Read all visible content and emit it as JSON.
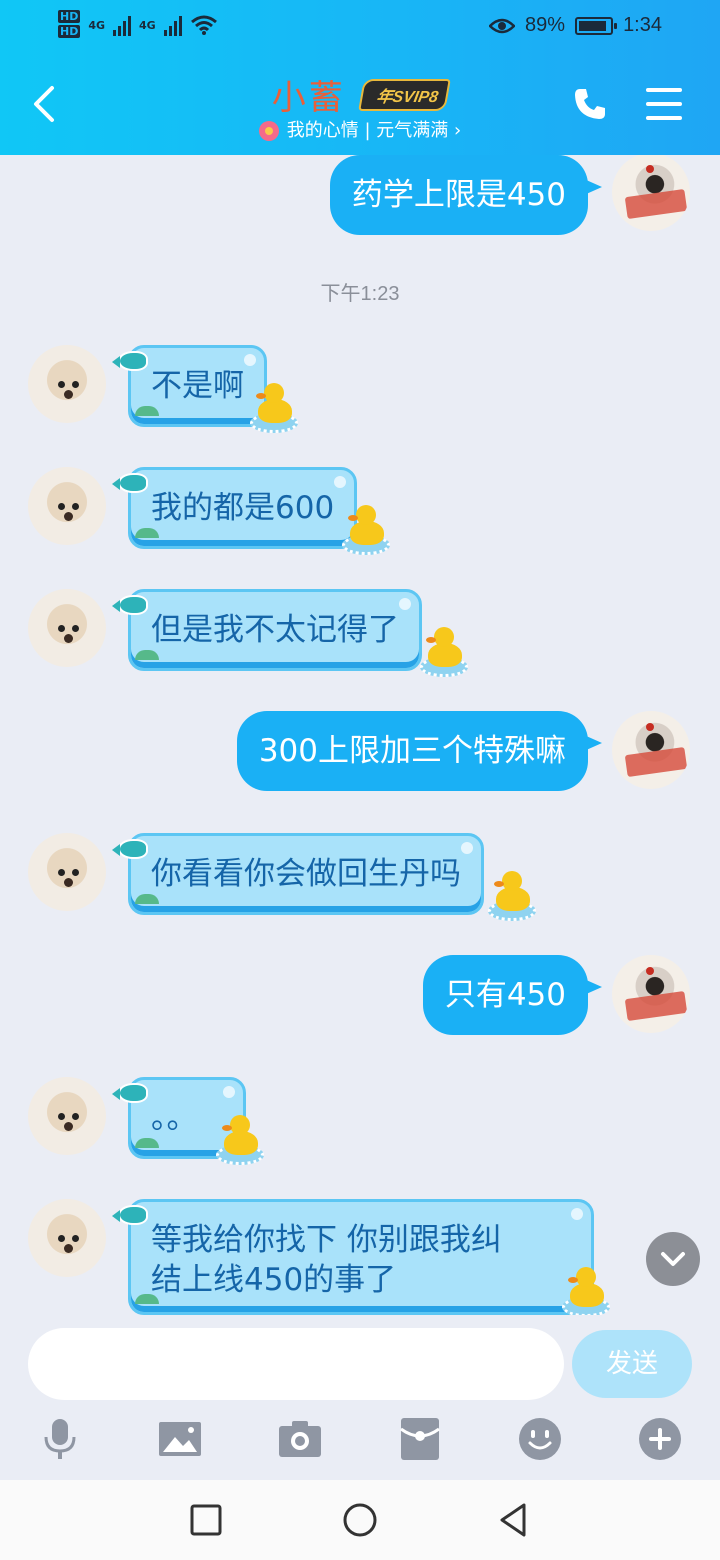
{
  "status_bar": {
    "hd1": "HD",
    "hd2": "HD",
    "net1": "4G",
    "net2": "4G",
    "battery": "89%",
    "battery_level": 0.89,
    "time": "1:34"
  },
  "header": {
    "contact_name": "小蓄",
    "badge": "年SVIP8",
    "mood": "我的心情 | 元气满满 ›"
  },
  "messages": [
    {
      "side": "me",
      "text": "药学上限是450"
    },
    {
      "type": "time",
      "text": "下午1:23"
    },
    {
      "side": "them",
      "text": "不是啊"
    },
    {
      "side": "them",
      "text": "我的都是600"
    },
    {
      "side": "them",
      "text": "但是我不太记得了"
    },
    {
      "side": "me",
      "text": "300上限加三个特殊嘛"
    },
    {
      "side": "them",
      "text": "你看看你会做回生丹吗"
    },
    {
      "side": "me",
      "text": "只有450"
    },
    {
      "side": "them",
      "text": "。。"
    },
    {
      "side": "them",
      "text_line1": "等我给你找下 你别跟我纠",
      "text_line2": "结上线450的事了"
    }
  ],
  "input": {
    "placeholder": "",
    "value": "",
    "send_label": "发送"
  },
  "toolbar": [
    "mic-icon",
    "image-icon",
    "camera-icon",
    "red-packet-icon",
    "emoji-icon",
    "plus-icon"
  ],
  "colors": {
    "header_start": "#10C7F6",
    "header_end": "#1FA6F4",
    "me_bubble": "#1AB0F5",
    "them_bubble": "#A9E2FA",
    "them_text": "#1565A8",
    "name": "#E8603A",
    "background": "#EAEDF5"
  }
}
